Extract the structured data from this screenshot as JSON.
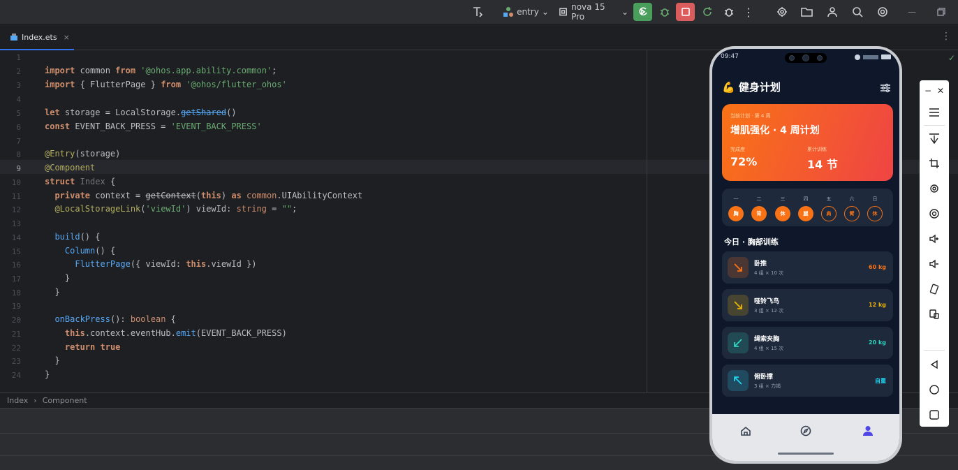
{
  "toolbar": {
    "entry_label": "entry",
    "device_label": "nova 15 Pro"
  },
  "tab": {
    "filename": "Index.ets",
    "close": "×"
  },
  "editor": {
    "line_numbers": [
      "1",
      "2",
      "3",
      "4",
      "5",
      "6",
      "7",
      "8",
      "9",
      "10",
      "11",
      "12",
      "13",
      "14",
      "15",
      "16",
      "17",
      "18",
      "19",
      "20",
      "21",
      "22",
      "23",
      "24"
    ]
  },
  "breadcrumb": {
    "items": [
      "Index",
      "Component"
    ],
    "separator": "›"
  },
  "phone": {
    "status": {
      "time": "09:47"
    },
    "title": "健身计划",
    "title_emoji": "💪",
    "hero": {
      "subtitle": "当前计划 · 第 4 周",
      "title": "增肌强化 · 4 周计划",
      "label1": "完成度",
      "value1": "72%",
      "label2": "累计训练",
      "value2": "14 节"
    },
    "week": {
      "days": [
        "一",
        "二",
        "三",
        "四",
        "五",
        "六",
        "日"
      ],
      "tags": [
        "胸",
        "背",
        "休",
        "腿",
        "肩",
        "臂",
        "休"
      ],
      "completed": [
        true,
        true,
        true,
        true,
        false,
        false,
        false
      ]
    },
    "section_title": "今日 · 胸部训练",
    "exercises": [
      {
        "name": "卧推",
        "sets": "4 组 × 10 次",
        "weight": "60 kg",
        "color": "#f97316"
      },
      {
        "name": "哑铃飞鸟",
        "sets": "3 组 × 12 次",
        "weight": "12 kg",
        "color": "#eab308"
      },
      {
        "name": "绳索夹胸",
        "sets": "4 组 × 15 次",
        "weight": "20 kg",
        "color": "#2dd4bf"
      },
      {
        "name": "俯卧撑",
        "sets": "3 组 × 力竭",
        "weight": "自重",
        "color": "#22d3ee"
      }
    ],
    "nav": [
      "home-icon",
      "compass-icon",
      "user-icon"
    ]
  },
  "colors": {
    "accent": "#3574f0",
    "run_green": "#4a9e5c",
    "stop_red": "#db5c5c",
    "phone_bg": "#0f172a",
    "hero_start": "#f97316",
    "hero_end": "#ef4444"
  }
}
